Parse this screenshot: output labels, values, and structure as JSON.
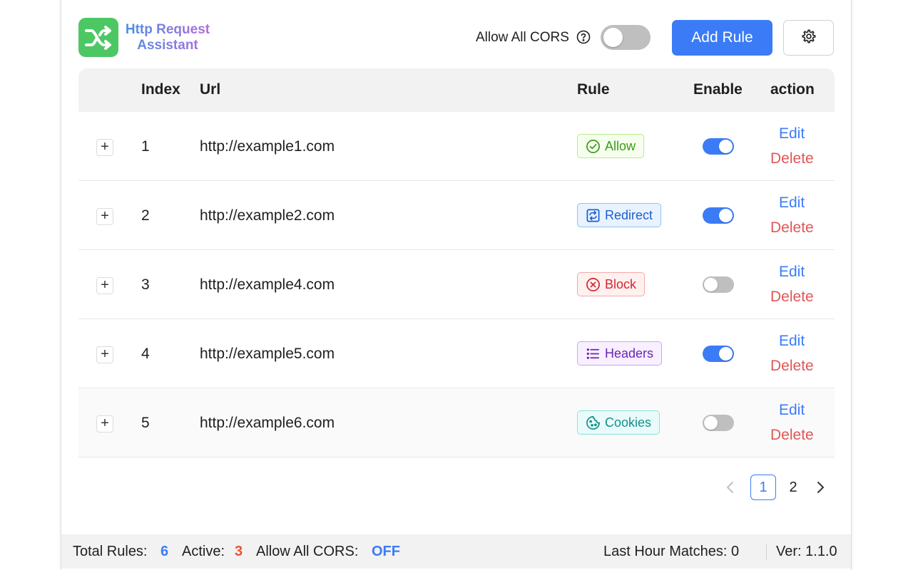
{
  "app": {
    "title_line1": "Http Request",
    "title_line2": "Assistant"
  },
  "header": {
    "cors_label": "Allow All CORS",
    "cors_enabled": false,
    "add_rule_label": "Add Rule"
  },
  "table": {
    "columns": [
      "Index",
      "Url",
      "Rule",
      "Enable",
      "action"
    ],
    "rows": [
      {
        "expand": "+",
        "index": "1",
        "url": "http://example1.com",
        "rule": "Allow",
        "rule_icon": "check-circle-icon",
        "enabled": true,
        "edit": "Edit",
        "delete": "Delete"
      },
      {
        "expand": "+",
        "index": "2",
        "url": "http://example2.com",
        "rule": "Redirect",
        "rule_icon": "redirect-icon",
        "enabled": true,
        "edit": "Edit",
        "delete": "Delete"
      },
      {
        "expand": "+",
        "index": "3",
        "url": "http://example4.com",
        "rule": "Block",
        "rule_icon": "close-circle-icon",
        "enabled": false,
        "edit": "Edit",
        "delete": "Delete"
      },
      {
        "expand": "+",
        "index": "4",
        "url": "http://example5.com",
        "rule": "Headers",
        "rule_icon": "list-icon",
        "enabled": true,
        "edit": "Edit",
        "delete": "Delete"
      },
      {
        "expand": "+",
        "index": "5",
        "url": "http://example6.com",
        "rule": "Cookies",
        "rule_icon": "cookie-icon",
        "enabled": false,
        "edit": "Edit",
        "delete": "Delete"
      }
    ]
  },
  "pagination": {
    "prev": "<",
    "pages": [
      "1",
      "2"
    ],
    "current": "1",
    "next": ">"
  },
  "footer": {
    "total_label": "Total Rules:",
    "total_value": "6",
    "active_label": "Active:",
    "active_value": "3",
    "cors_label": "Allow All CORS:",
    "cors_value": "OFF",
    "matches": "Last Hour Matches: 0",
    "version": "Ver: 1.1.0"
  },
  "colors": {
    "primary": "#3b7cf6",
    "danger": "#e05656",
    "logo_green": "#4cc764"
  }
}
